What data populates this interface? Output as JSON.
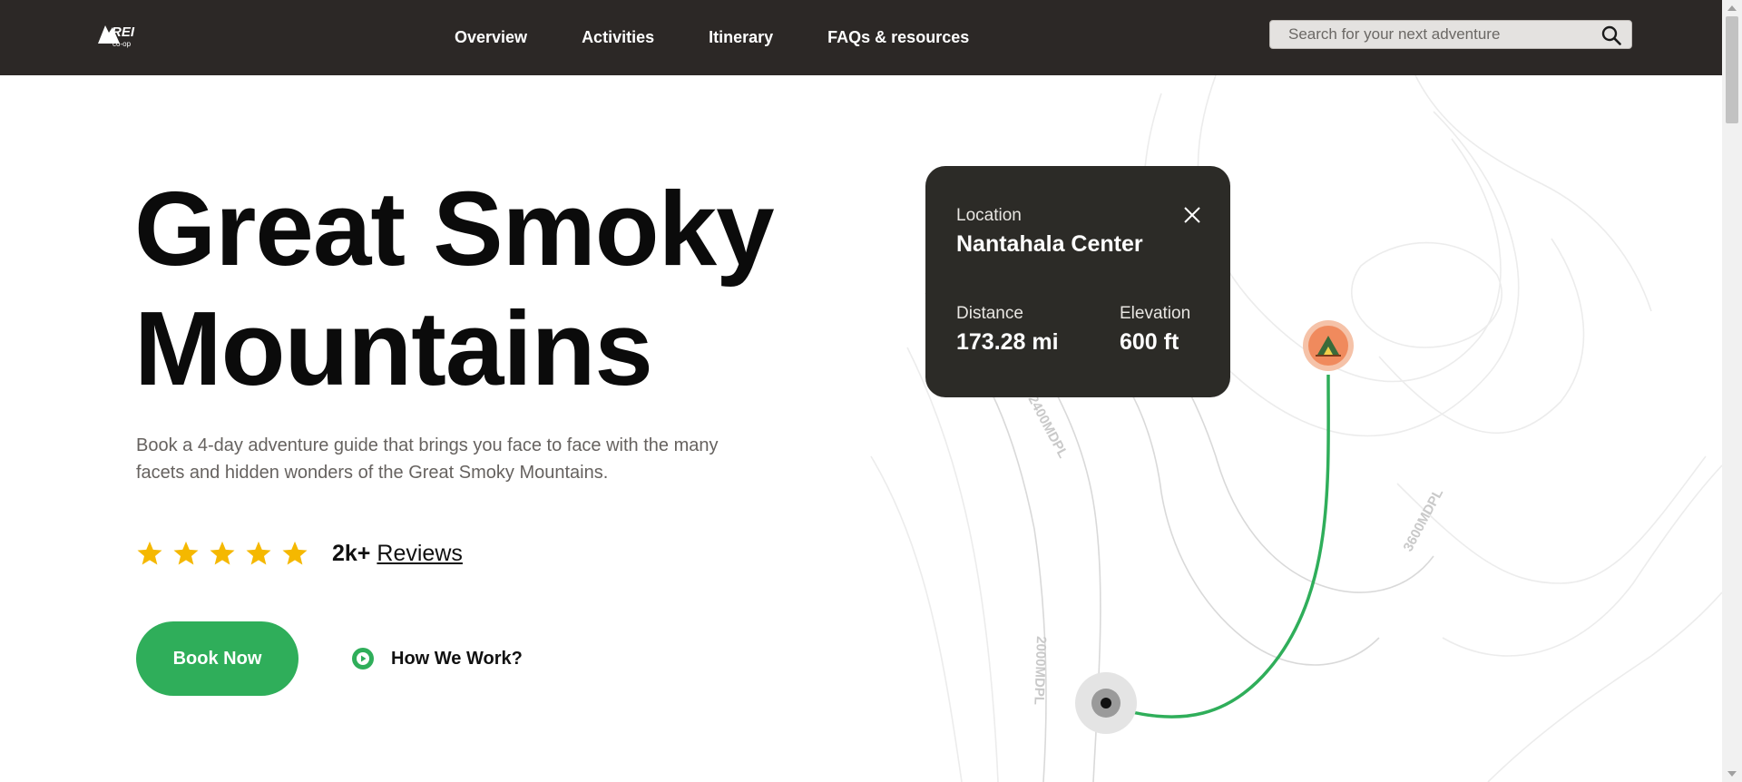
{
  "header": {
    "logo_alt": "REI co-op",
    "nav": [
      "Overview",
      "Activities",
      "Itinerary",
      "FAQs & resources"
    ],
    "search_placeholder": "Search for your next adventure"
  },
  "hero": {
    "title_line1": "Great Smoky",
    "title_line2": "Mountains",
    "description": "Book a 4-day adventure guide that brings you face to face with the many facets and hidden wonders of the Great Smoky Mountains.",
    "rating_stars": 5,
    "reviews_count": "2k+",
    "reviews_link": "Reviews",
    "book_button": "Book Now",
    "how_link": "How We Work?"
  },
  "map": {
    "contour_labels": [
      "2400MDPL",
      "3600MDPL",
      "2000MDPL"
    ],
    "card": {
      "location_label": "Location",
      "location_value": "Nantahala Center",
      "distance_label": "Distance",
      "distance_value": "173.28 mi",
      "elevation_label": "Elevation",
      "elevation_value": "600 ft"
    }
  },
  "colors": {
    "header_bg": "#2c2826",
    "accent_green": "#2fae5a",
    "star_yellow": "#f5b800",
    "card_bg": "#2c2b27",
    "pin_orange": "#f08a5d"
  },
  "icons": [
    "rei-logo",
    "search-icon",
    "star-icon",
    "play-icon",
    "close-icon",
    "campsite-pin-icon",
    "start-point-icon"
  ]
}
